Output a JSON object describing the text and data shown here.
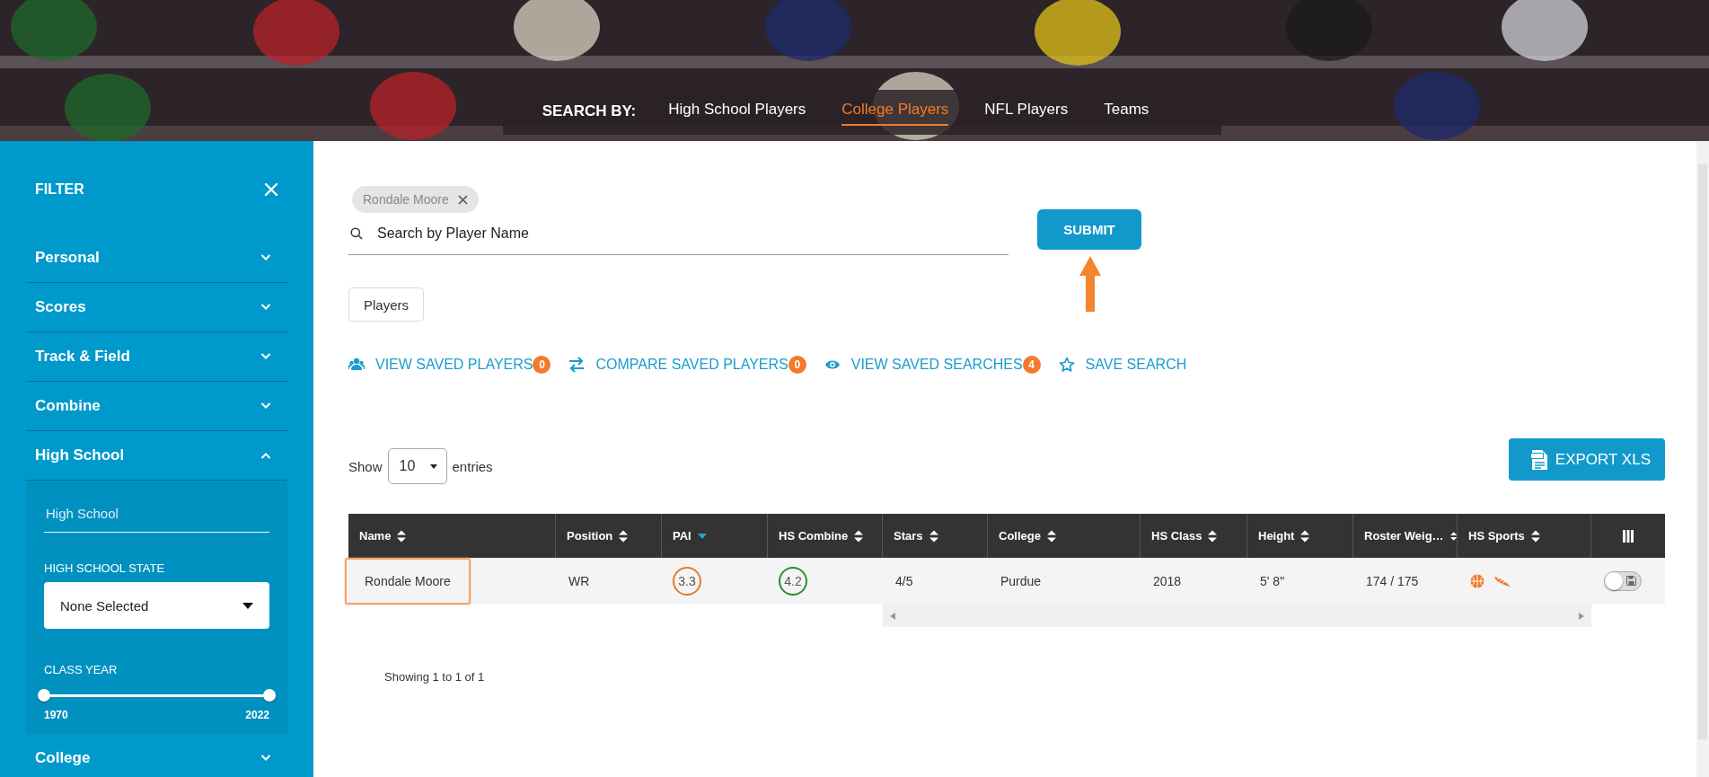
{
  "header": {
    "search_by": "SEARCH BY:",
    "tabs": [
      {
        "label": "High School Players",
        "selected": false
      },
      {
        "label": "College Players",
        "selected": true
      },
      {
        "label": "NFL Players",
        "selected": false
      },
      {
        "label": "Teams",
        "selected": false
      }
    ]
  },
  "filter": {
    "title": "FILTER",
    "sections": [
      {
        "label": "Personal",
        "expanded": false
      },
      {
        "label": "Scores",
        "expanded": false
      },
      {
        "label": "Track & Field",
        "expanded": false
      },
      {
        "label": "Combine",
        "expanded": false
      },
      {
        "label": "High School",
        "expanded": true,
        "fields": {
          "school": {
            "placeholder": "High School"
          },
          "state": {
            "label": "HIGH SCHOOL STATE",
            "value": "None Selected"
          },
          "class_year": {
            "label": "CLASS YEAR",
            "thumbs": [
              {
                "level": 0
              },
              {
                "level": 1
              }
            ],
            "min": "1970",
            "max": "2022"
          }
        }
      },
      {
        "label": "College",
        "expanded": false
      }
    ]
  },
  "search": {
    "chips": [
      "Rondale Moore"
    ],
    "placeholder": "Search by Player Name",
    "submit": "SUBMIT",
    "types": [
      "Players"
    ]
  },
  "links": [
    {
      "kind": "people",
      "label": "VIEW SAVED PLAYERS",
      "count": "0"
    },
    {
      "kind": "compare",
      "label": "COMPARE SAVED PLAYERS",
      "count": "0"
    },
    {
      "kind": "eye",
      "label": "VIEW SAVED SEARCHES",
      "count": "4"
    },
    {
      "kind": "star",
      "label": "SAVE SEARCH"
    }
  ],
  "table": {
    "show": "Show",
    "page_size": "10",
    "entries": "entries",
    "export": "EXPORT XLS",
    "columns": [
      {
        "label": "Name",
        "sorted": false
      },
      {
        "label": "Position",
        "sorted": false
      },
      {
        "label": "PAI",
        "sorted": true
      },
      {
        "label": "HS Combine",
        "sorted": false
      },
      {
        "label": "Stars",
        "sorted": false
      },
      {
        "label": "College",
        "sorted": false
      },
      {
        "label": "HS Class",
        "sorted": false
      },
      {
        "label": "Height",
        "sorted": false
      },
      {
        "label": "Roster Weig…",
        "sorted": false
      },
      {
        "label": "HS Sports",
        "sorted": false
      }
    ],
    "rows": [
      {
        "name": {
          "text": "Rondale Moore",
          "highlighted": true
        },
        "position": "WR",
        "pai": {
          "text": "3.3",
          "color": "#e87a2e"
        },
        "hs_combine": {
          "text": "4.2",
          "color": "#2f8a2f"
        },
        "stars": "4/5",
        "college": "Purdue",
        "hs_class": "2018",
        "height": "5' 8\"",
        "weight": "174 / 175",
        "hs_sports": [
          {
            "kind": "basketball"
          },
          {
            "kind": "track"
          }
        ],
        "saved": {
          "on": false
        }
      }
    ],
    "footer": "Showing 1 to 1 of 1"
  }
}
